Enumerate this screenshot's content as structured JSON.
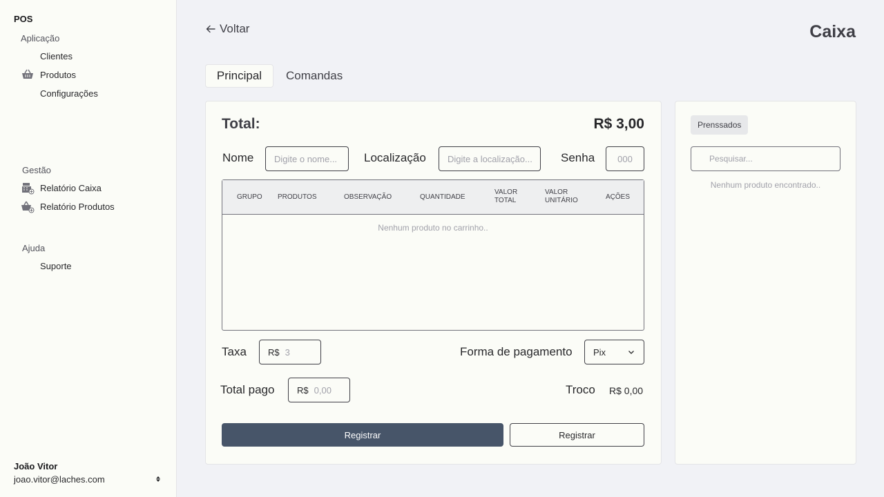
{
  "sidebar": {
    "brand": "POS",
    "sections": {
      "aplicacao": {
        "title": "Aplicação",
        "items": [
          {
            "label": "Clientes",
            "icon": "none"
          },
          {
            "label": "Produtos",
            "icon": "basket-icon"
          },
          {
            "label": "Configurações",
            "icon": "none"
          }
        ]
      },
      "gestao": {
        "title": "Gestão",
        "items": [
          {
            "label": "Relatório Caixa",
            "icon": "register-report-icon"
          },
          {
            "label": "Relatório Produtos",
            "icon": "basket-report-icon"
          }
        ]
      },
      "ajuda": {
        "title": "Ajuda",
        "items": [
          {
            "label": "Suporte",
            "icon": "none"
          }
        ]
      }
    },
    "user": {
      "name": "João Vitor",
      "email": "joao.vitor@laches.com"
    }
  },
  "header": {
    "back_label": "Voltar",
    "title": "Caixa"
  },
  "tabs": [
    {
      "label": "Principal",
      "active": true
    },
    {
      "label": "Comandas",
      "active": false
    }
  ],
  "order": {
    "total_label": "Total:",
    "total_value": "R$ 3,00",
    "fields": {
      "nome": {
        "label": "Nome",
        "placeholder": "Digite o nome...",
        "value": ""
      },
      "localizacao": {
        "label": "Localização",
        "placeholder": "Digite a localização...",
        "value": ""
      },
      "senha": {
        "label": "Senha",
        "placeholder": "000",
        "value": ""
      }
    },
    "table": {
      "columns": [
        "Grupo",
        "Produtos",
        "Observação",
        "Quantidade",
        "Valor total",
        "Valor unitário",
        "Ações"
      ],
      "rows": [],
      "empty_text": "Nenhum produto no carrinho.."
    },
    "taxa": {
      "label": "Taxa",
      "prefix": "R$",
      "placeholder": "3"
    },
    "payment": {
      "label": "Forma de pagamento",
      "selected": "Pix"
    },
    "total_pago": {
      "label": "Total pago",
      "prefix": "R$",
      "placeholder": "0,00"
    },
    "troco": {
      "label": "Troco",
      "value": "R$ 0,00"
    },
    "buttons": {
      "primary": "Registrar",
      "secondary": "Registrar"
    }
  },
  "products_panel": {
    "chip_label": "Prenssados",
    "search_placeholder": "Pesquisar...",
    "empty_text": "Nenhum produto encontrado.."
  },
  "colors": {
    "primary_button": "#475569",
    "sidebar_bg": "#fbfcf7",
    "page_bg": "#f1f2f6"
  }
}
